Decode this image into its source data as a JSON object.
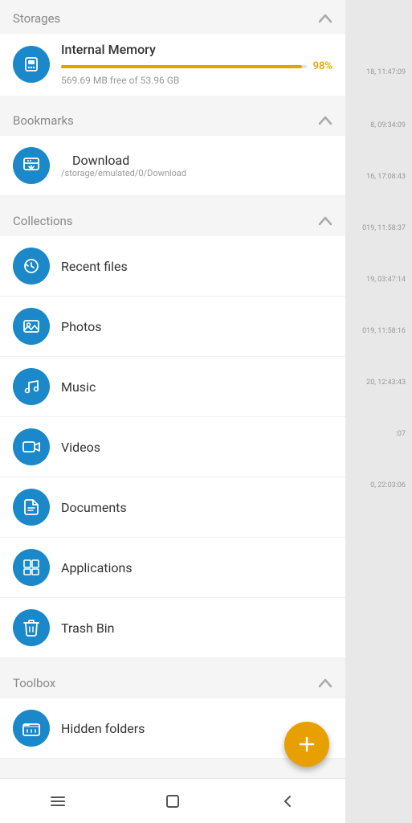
{
  "storages": {
    "section_title": "Storages",
    "item": {
      "name": "Internal Memory",
      "percent": "98%",
      "sub": "569.69 MB free of 53.96 GB",
      "fill_width": "98%"
    }
  },
  "bookmarks": {
    "section_title": "Bookmarks",
    "item": {
      "name": "Download",
      "path": "/storage/emulated/0/Download"
    }
  },
  "collections": {
    "section_title": "Collections",
    "items": [
      {
        "label": "Recent files"
      },
      {
        "label": "Photos"
      },
      {
        "label": "Music"
      },
      {
        "label": "Videos"
      },
      {
        "label": "Documents"
      },
      {
        "label": "Applications"
      },
      {
        "label": "Trash Bin"
      }
    ]
  },
  "toolbox": {
    "section_title": "Toolbox",
    "item": {
      "label": "Hidden folders"
    }
  },
  "timestamps": {
    "t1": "18, 11:47:09",
    "t2": "8, 09:34:09",
    "t3": "16, 17:08:43",
    "t4": "019, 11:58:37",
    "t5": "19, 03:47:14",
    "t6": "019, 11:58:16",
    "t7": "20, 12:43:43",
    "t8": ":07",
    "t9": "0, 22:03:06"
  },
  "fab": {
    "label": "+"
  }
}
